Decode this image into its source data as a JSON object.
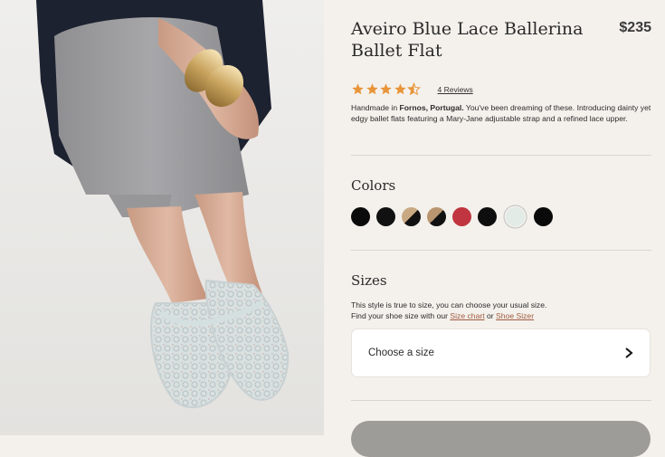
{
  "product": {
    "title": "Aveiro Blue Lace Ballerina Ballet Flat",
    "price": "$235",
    "rating": 4.5,
    "reviews_label": "4 Reviews",
    "description": {
      "prefix": "Handmade in ",
      "origin": "Fornos, Portugal.",
      "body": " You've been dreaming of these. Introducing dainty yet edgy ballet flats featuring a Mary-Jane adjustable strap and a refined lace upper."
    }
  },
  "colors": {
    "heading": "Colors",
    "swatches": [
      {
        "name": "black",
        "color": "#0b0b0b"
      },
      {
        "name": "black-2",
        "color": "#111111"
      },
      {
        "name": "tan-black",
        "color_a": "#c9a983",
        "color_b": "#111111"
      },
      {
        "name": "black-tan",
        "color_a": "#111111",
        "color_b": "#b99670"
      },
      {
        "name": "red",
        "color": "#c0353f"
      },
      {
        "name": "black-3",
        "color": "#0e0e0e"
      },
      {
        "name": "light-blue",
        "color": "#e2ebe6"
      },
      {
        "name": "black-4",
        "color": "#0a0a0a"
      }
    ]
  },
  "sizes": {
    "heading": "Sizes",
    "note_line1": "This style is true to size, you can choose your usual size.",
    "note_line2_prefix": "Find your shoe size with our ",
    "size_chart_link": "Size chart",
    "or_text": " or ",
    "shoe_sizer_link": "Shoe Sizer",
    "select_label": "Choose a size"
  },
  "theme": {
    "accent_star": "#e8953a",
    "link_color": "#a05a3f"
  }
}
